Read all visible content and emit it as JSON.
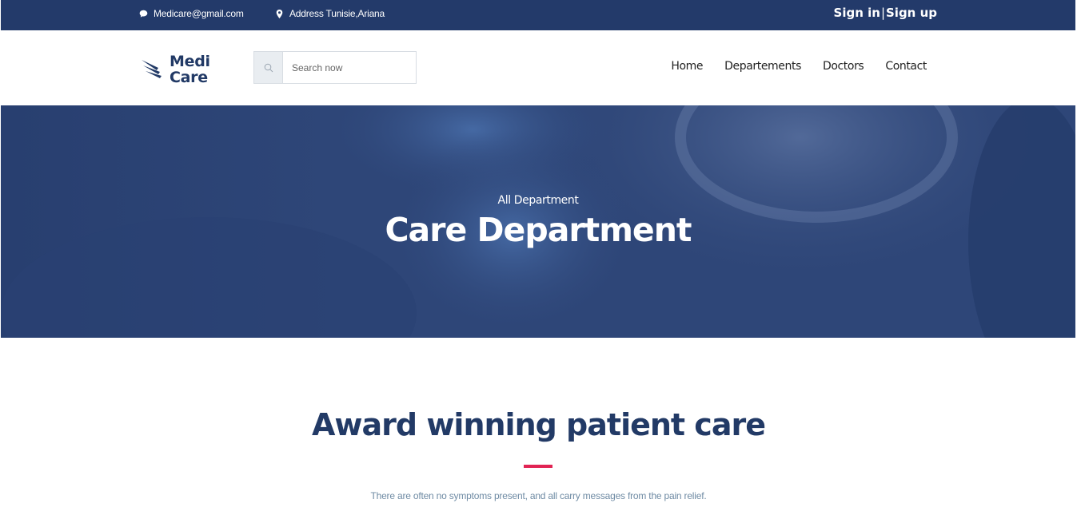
{
  "topbar": {
    "email": "Medicare@gmail.com",
    "address": "Address Tunisie,Ariana",
    "sign_in": "Sign in",
    "separator": "|",
    "sign_up": "Sign up",
    "icons": {
      "email": "chat-bubble-icon",
      "address": "map-pin-icon"
    }
  },
  "header": {
    "logo": {
      "line1": "Medi",
      "line2": "Care",
      "icon": "wing-logo-icon"
    },
    "search": {
      "placeholder": "Search now",
      "icon": "search-icon"
    },
    "nav": [
      {
        "label": "Home"
      },
      {
        "label": "Departements"
      },
      {
        "label": "Doctors"
      },
      {
        "label": "Contact"
      }
    ]
  },
  "hero": {
    "subtitle": "All Department",
    "title": "Care Department"
  },
  "section": {
    "title": "Award winning patient care",
    "text": "There are often no symptoms present, and all carry messages from the pain relief."
  },
  "colors": {
    "primary": "#223a66",
    "topbar": "#233a6a",
    "accent": "#e12454",
    "muted_text": "#6f8ba4"
  }
}
